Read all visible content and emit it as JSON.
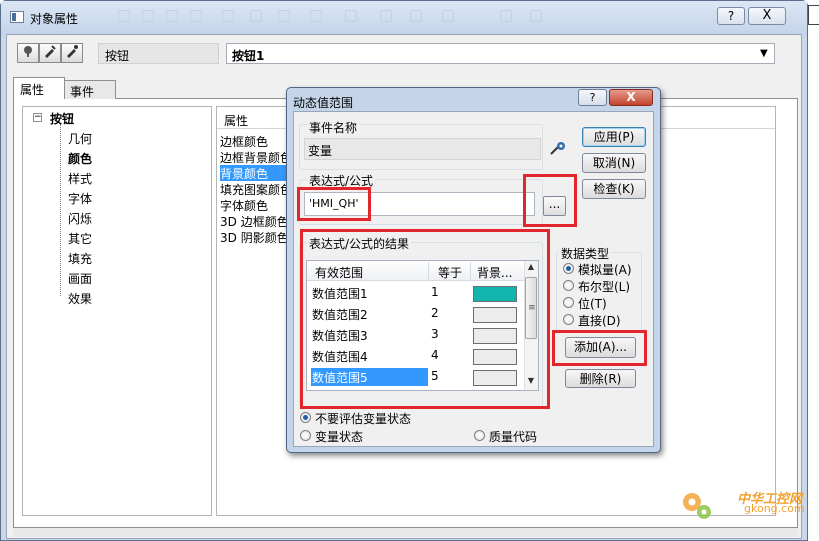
{
  "main_window": {
    "title": "对象属性",
    "help_label": "?",
    "close_label": "X",
    "object_type": "按钮",
    "object_name": "按钮1",
    "tabs": [
      {
        "label": "属性"
      },
      {
        "label": "事件"
      }
    ]
  },
  "tree": {
    "root": "按钮",
    "items": [
      "几何",
      "颜色",
      "样式",
      "字体",
      "闪烁",
      "其它",
      "填充",
      "画面",
      "效果"
    ],
    "bold_item": "颜色"
  },
  "properties": {
    "header": "属性",
    "items": [
      "边框颜色",
      "边框背景颜色",
      "背景颜色",
      "填充图案颜色",
      "字体颜色",
      "3D 边框颜色",
      "3D 阴影颜色"
    ],
    "selected": "背景颜色"
  },
  "dialog": {
    "title": "动态值范围",
    "help_label": "?",
    "close_label": "X",
    "event_name_label": "事件名称",
    "event_name_value": "变量",
    "expr_label": "表达式/公式",
    "expr_value": "'HMI_QH'",
    "browse_label": "...",
    "apply_label": "应用(P)",
    "cancel_label": "取消(N)",
    "check_label": "检查(K)",
    "result_label": "表达式/公式的结果",
    "columns": [
      "有效范围",
      "等于",
      "背景..."
    ],
    "rows": [
      {
        "name": "数值范围1",
        "value": "1",
        "color": "#12b5ad"
      },
      {
        "name": "数值范围2",
        "value": "2",
        "color": "#ececec"
      },
      {
        "name": "数值范围3",
        "value": "3",
        "color": "#ececec"
      },
      {
        "name": "数值范围4",
        "value": "4",
        "color": "#ececec"
      },
      {
        "name": "数值范围5",
        "value": "5",
        "color": "#ececec"
      }
    ],
    "selected_row": "数值范围5",
    "datatype_label": "数据类型",
    "datatypes": [
      {
        "label": "模拟量(A)",
        "checked": true
      },
      {
        "label": "布尔型(L)",
        "checked": false
      },
      {
        "label": "位(T)",
        "checked": false
      },
      {
        "label": "直接(D)",
        "checked": false
      }
    ],
    "add_label": "添加(A)...",
    "delete_label": "删除(R)",
    "eval_options": [
      {
        "label": "不要评估变量状态",
        "checked": true
      },
      {
        "label": "变量状态",
        "checked": false
      },
      {
        "label": "质量代码",
        "checked": false
      }
    ]
  },
  "watermark": {
    "name": "中华工控网",
    "url": "gkong.com"
  },
  "colors": {
    "highlight": "#e1262d",
    "selection": "#3399ff",
    "accent": "#12b5ad"
  }
}
